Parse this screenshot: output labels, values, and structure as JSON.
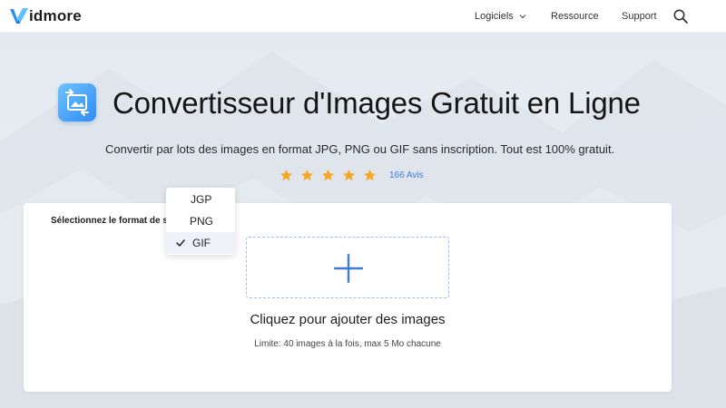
{
  "header": {
    "logo_text": "idmore",
    "nav": {
      "logiciels": "Logiciels",
      "ressource": "Ressource",
      "support": "Support"
    }
  },
  "hero": {
    "title": "Convertisseur d'Images Gratuit en Ligne",
    "subtitle": "Convertir par lots des images en format JPG, PNG ou GIF sans inscription. Tout est 100% gratuit.",
    "rating": {
      "stars": 5,
      "reviews": "166 Avis"
    }
  },
  "converter": {
    "format_label": "Sélectionnez le format de sortie :",
    "add_images": "Cliquez pour ajouter des images",
    "limit": "Limite: 40 images à la fois, max 5 Mo chacune"
  },
  "format_dropdown": {
    "options": [
      "JGP",
      "PNG",
      "GIF"
    ],
    "selected": "GIF"
  },
  "colors": {
    "accent": "#3b7de0",
    "star": "#f5a623",
    "logo_blue": "#2f8cf2"
  },
  "icons": {
    "logo": "vidmore-v-logo",
    "app": "image-convert-icon",
    "search": "search-icon",
    "chevron": "chevron-down-icon",
    "plus": "plus-icon",
    "check": "check-icon",
    "star": "star-icon"
  }
}
